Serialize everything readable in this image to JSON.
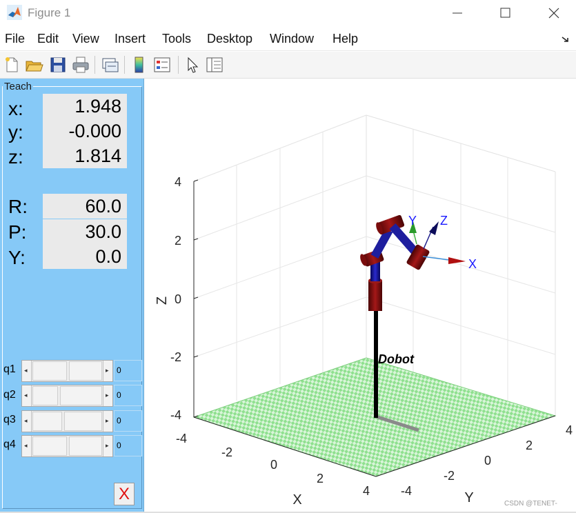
{
  "window": {
    "title": "Figure 1"
  },
  "menu": [
    "File",
    "Edit",
    "View",
    "Insert",
    "Tools",
    "Desktop",
    "Window",
    "Help"
  ],
  "toolbar": {
    "icons": [
      "new-figure-icon",
      "open-file-icon",
      "save-icon",
      "print-icon",
      "link-plot-icon",
      "colorbar-icon",
      "legend-icon",
      "pointer-icon",
      "property-inspector-icon"
    ]
  },
  "teach": {
    "title": "Teach",
    "position": {
      "x_label": "x:",
      "x_value": "1.948",
      "y_label": "y:",
      "y_value": "-0.000",
      "z_label": "z:",
      "z_value": "1.814"
    },
    "orientation": {
      "r_label": "R:",
      "r_value": "60.0",
      "p_label": "P:",
      "p_value": "30.0",
      "y_label": "Y:",
      "y_value": "0.0"
    },
    "joints": [
      {
        "label": "q1",
        "value": "0"
      },
      {
        "label": "q2",
        "value": "0"
      },
      {
        "label": "q3",
        "value": "0"
      },
      {
        "label": "q4",
        "value": "0"
      }
    ],
    "quit_label": "X"
  },
  "axes": {
    "z_ticks": [
      "4",
      "2",
      "0",
      "-2",
      "-4"
    ],
    "x_ticks": [
      "-4",
      "-2",
      "0",
      "2",
      "4"
    ],
    "y_ticks": [
      "-4",
      "-2",
      "0",
      "2",
      "4"
    ],
    "xlabel": "X",
    "ylabel": "Y",
    "zlabel": "Z"
  },
  "robot": {
    "name": "Dobot",
    "frame_labels": {
      "x": "X",
      "y": "Y",
      "z": "Z"
    }
  },
  "watermark": "CSDN @TENET-",
  "colors": {
    "panel": "#86c9f7",
    "floor_green": "#8fe08f",
    "link_blue": "#1a1a9a",
    "joint_red": "#8a1010"
  }
}
